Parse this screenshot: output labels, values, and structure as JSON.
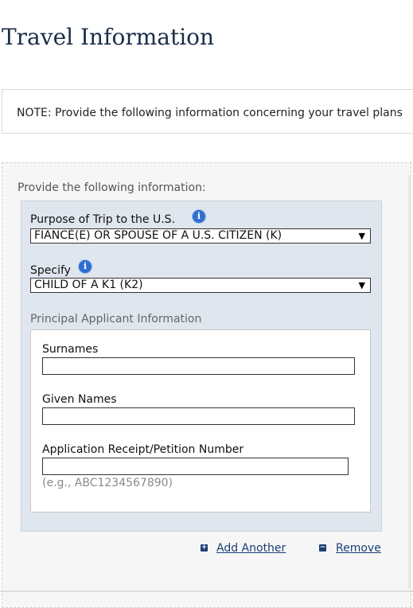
{
  "page": {
    "title": "Travel Information"
  },
  "note": {
    "text": "NOTE: Provide the following information concerning your travel plans"
  },
  "form": {
    "instruction": "Provide the following information:",
    "purpose": {
      "label": "Purpose of Trip to the U.S.",
      "value": "FIANCÉ(E) OR SPOUSE OF A U.S. CITIZEN (K)",
      "help_icon": "info-icon"
    },
    "specify": {
      "label": "Specify",
      "value": "CHILD OF A K1 (K2)",
      "help_icon": "info-icon"
    },
    "principal_applicant": {
      "heading": "Principal Applicant Information",
      "surnames": {
        "label": "Surnames",
        "value": ""
      },
      "given_names": {
        "label": "Given Names",
        "value": ""
      },
      "receipt_number": {
        "label": "Application Receipt/Petition Number",
        "value": "",
        "hint": "(e.g., ABC1234567890)"
      }
    },
    "actions": {
      "add_label": "Add Another",
      "add_icon": "+",
      "remove_label": "Remove",
      "remove_icon": "−"
    }
  },
  "colors": {
    "title": "#1b2d4a",
    "panel_bg": "#f6f6f6",
    "inner_panel_bg": "#dfe6ee",
    "link": "#1a3f78",
    "help_icon": "#2f6fd1"
  }
}
